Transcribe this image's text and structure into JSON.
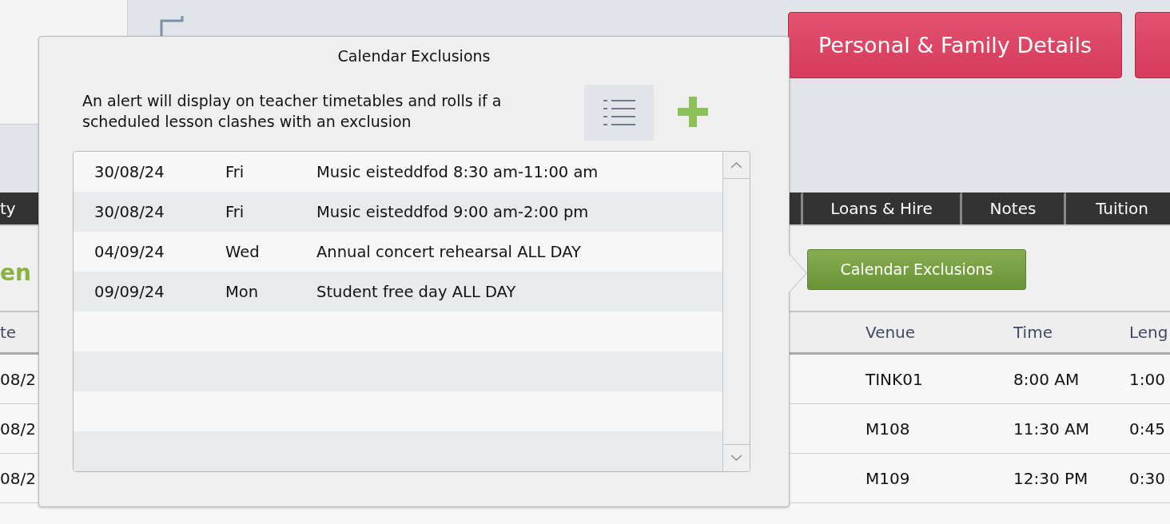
{
  "header": {
    "buttons": [
      {
        "label": "Personal & Family Details"
      }
    ]
  },
  "tabs": [
    {
      "label": "ty"
    },
    {
      "label": "Loans & Hire"
    },
    {
      "label": "Notes"
    },
    {
      "label": "Tuition"
    }
  ],
  "section_heading": "en",
  "calendar_exclusions_button": {
    "label": "Calendar Exclusions"
  },
  "table": {
    "columns": [
      "te",
      "Venue",
      "Time",
      "Leng"
    ],
    "rows": [
      [
        "08/2",
        "TINK01",
        "8:00 AM",
        "1:00"
      ],
      [
        "08/2",
        "M108",
        "11:30 AM",
        "0:45"
      ],
      [
        "08/2",
        "M109",
        "12:30 PM",
        "0:30"
      ]
    ]
  },
  "popup": {
    "title": "Calendar Exclusions",
    "description": "An alert will display on teacher timetables and rolls if a scheduled lesson clashes with an exclusion",
    "exclusions": [
      {
        "date": "30/08/24",
        "day": "Fri",
        "description": "Music eisteddfod 8:30 am-11:00 am"
      },
      {
        "date": "30/08/24",
        "day": "Fri",
        "description": "Music eisteddfod 9:00 am-2:00 pm"
      },
      {
        "date": "04/09/24",
        "day": "Wed",
        "description": "Annual concert rehearsal ALL DAY"
      },
      {
        "date": "09/09/24",
        "day": "Mon",
        "description": "Student free day ALL DAY"
      }
    ]
  }
}
